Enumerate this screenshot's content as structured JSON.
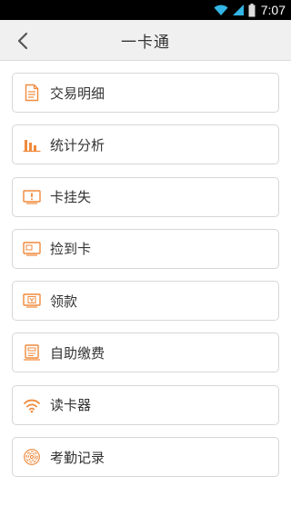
{
  "status_bar": {
    "time": "7:07"
  },
  "header": {
    "title": "一卡通"
  },
  "accent_color": "#f08a3c",
  "menu": {
    "items": [
      {
        "label": "交易明细",
        "icon": "document-icon"
      },
      {
        "label": "统计分析",
        "icon": "bar-chart-icon"
      },
      {
        "label": "卡挂失",
        "icon": "card-alert-icon"
      },
      {
        "label": "捡到卡",
        "icon": "card-found-icon"
      },
      {
        "label": "领款",
        "icon": "money-icon"
      },
      {
        "label": "自助缴费",
        "icon": "payment-icon"
      },
      {
        "label": "读卡器",
        "icon": "wifi-icon"
      },
      {
        "label": "考勤记录",
        "icon": "fingerprint-icon"
      }
    ]
  }
}
